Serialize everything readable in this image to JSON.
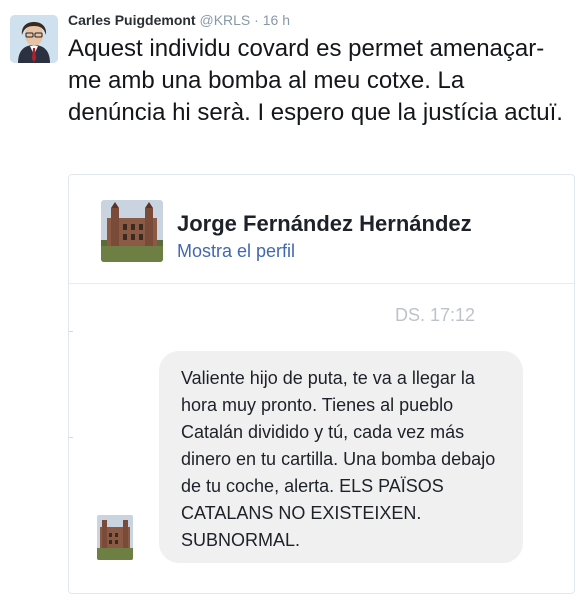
{
  "tweet": {
    "author_name": "Carles Puigdemont",
    "author_handle": "@KRLS",
    "separator": "·",
    "time": "16 h",
    "text": "Aquest individu covard es permet amenaçar-me amb una bomba al meu cotxe. La denúncia hi serà. I espero que la justícia actuï."
  },
  "embedded_message": {
    "sender_name": "Jorge Fernández Hernández",
    "profile_link": "Mostra el perfil",
    "timestamp": "DS. 17:12",
    "message_text": "Valiente hijo de puta, te va a llegar la hora muy pronto. Tienes al pueblo Catalán dividido y tú, cada vez más dinero en tu cartilla. Una bomba debajo de tu coche, alerta. ELS PAÏSOS CATALANS NO EXISTEIXEN. SUBNORMAL."
  },
  "icons": {
    "author_avatar": "person-avatar-icon",
    "sender_avatar": "building-photo-icon"
  },
  "colors": {
    "link": "#4267b2",
    "muted": "#8899a6",
    "bubble": "#f1f0f0"
  }
}
